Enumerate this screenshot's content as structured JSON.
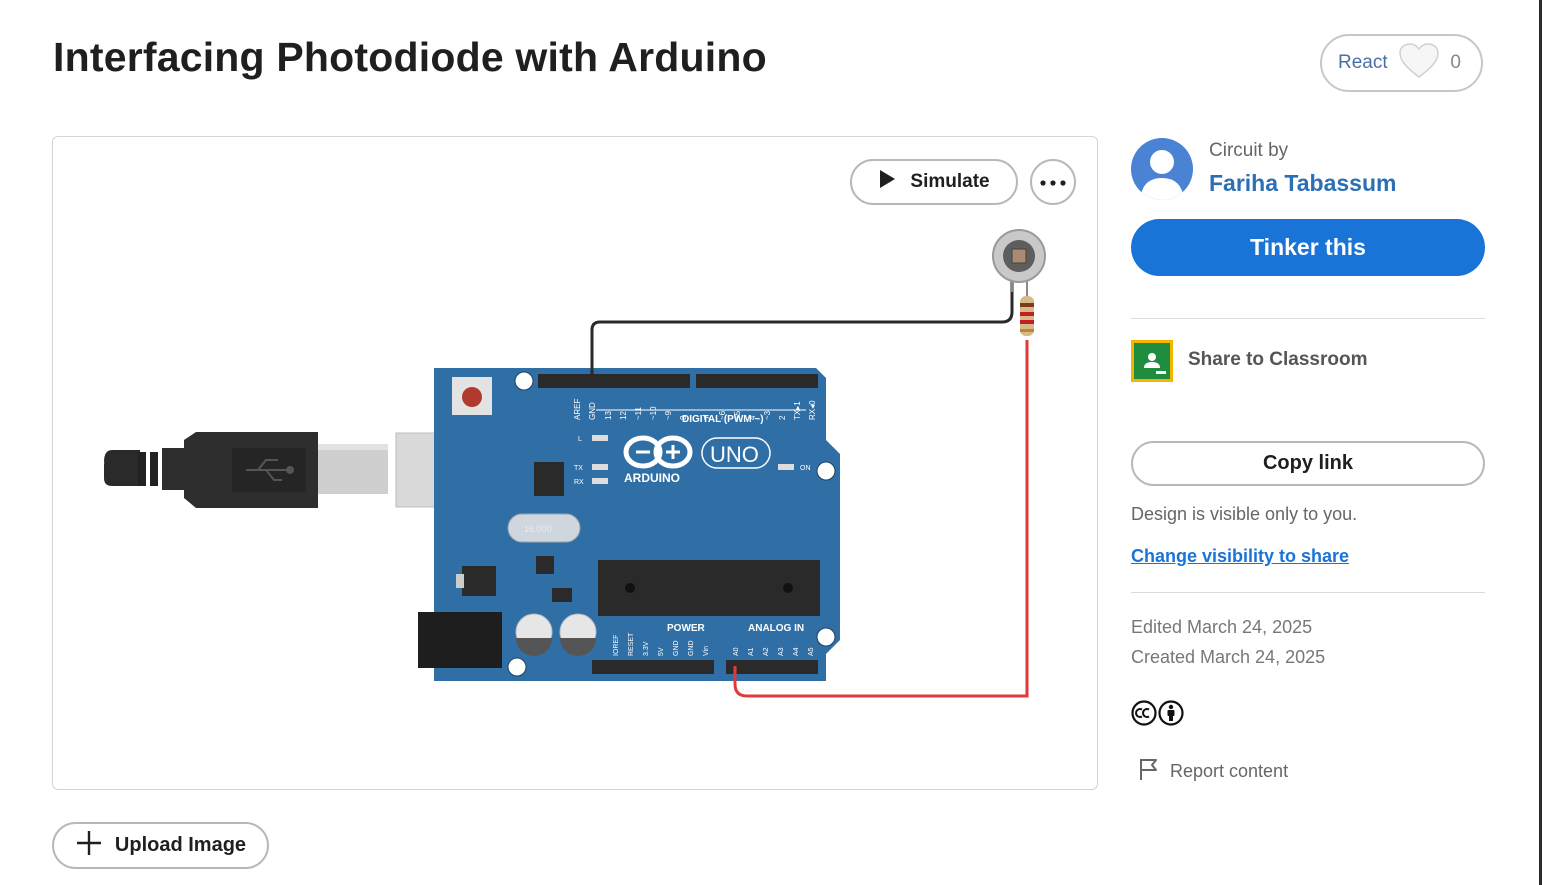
{
  "page": {
    "title": "Interfacing Photodiode with Arduino"
  },
  "react": {
    "label": "React",
    "count": "0",
    "icon": "heart-icon"
  },
  "viewer": {
    "simulate_label": "Simulate",
    "simulate_icon": "play-icon",
    "more_icon": "more-dots-icon",
    "board": {
      "pin_labels_top": [
        "AREF",
        "GND",
        "13",
        "12",
        "~11",
        "~10",
        "~9",
        "8",
        "7",
        "~6",
        "~5",
        "4",
        "~3",
        "2",
        "TX▸1",
        "RX◂0"
      ],
      "digital_label": "DIGITAL (PWM ~)",
      "logo_text": "ARDUINO",
      "model_text": "UNO",
      "led_labels": [
        "L",
        "TX",
        "RX"
      ],
      "on_label": "ON",
      "crystal_text": "16.000",
      "power_label": "POWER",
      "analog_label": "ANALOG IN",
      "pin_labels_power": [
        "IOREF",
        "RESET",
        "3.3V",
        "5V",
        "GND",
        "GND",
        "Vin"
      ],
      "pin_labels_analog": [
        "A0",
        "A1",
        "A2",
        "A3",
        "A4",
        "A5"
      ]
    },
    "colors": {
      "board": "#2f6fa6",
      "wire_red": "#e03a3a",
      "wire_black": "#2a2a2a"
    }
  },
  "sidebar": {
    "circuit_by": "Circuit by",
    "author": "Fariha Tabassum",
    "tinker_label": "Tinker this",
    "share_classroom_label": "Share to Classroom",
    "copy_link_label": "Copy link",
    "visibility_note": "Design is visible only to you.",
    "change_visibility_label": "Change visibility to share",
    "edited": "Edited March 24, 2025",
    "created": "Created March 24, 2025",
    "license_icons": [
      "cc-icon",
      "attribution-icon"
    ],
    "report_label": "Report content",
    "report_icon": "flag-icon"
  },
  "upload": {
    "label": "Upload Image",
    "icon": "plus-icon"
  },
  "accent": "#1a73d6"
}
